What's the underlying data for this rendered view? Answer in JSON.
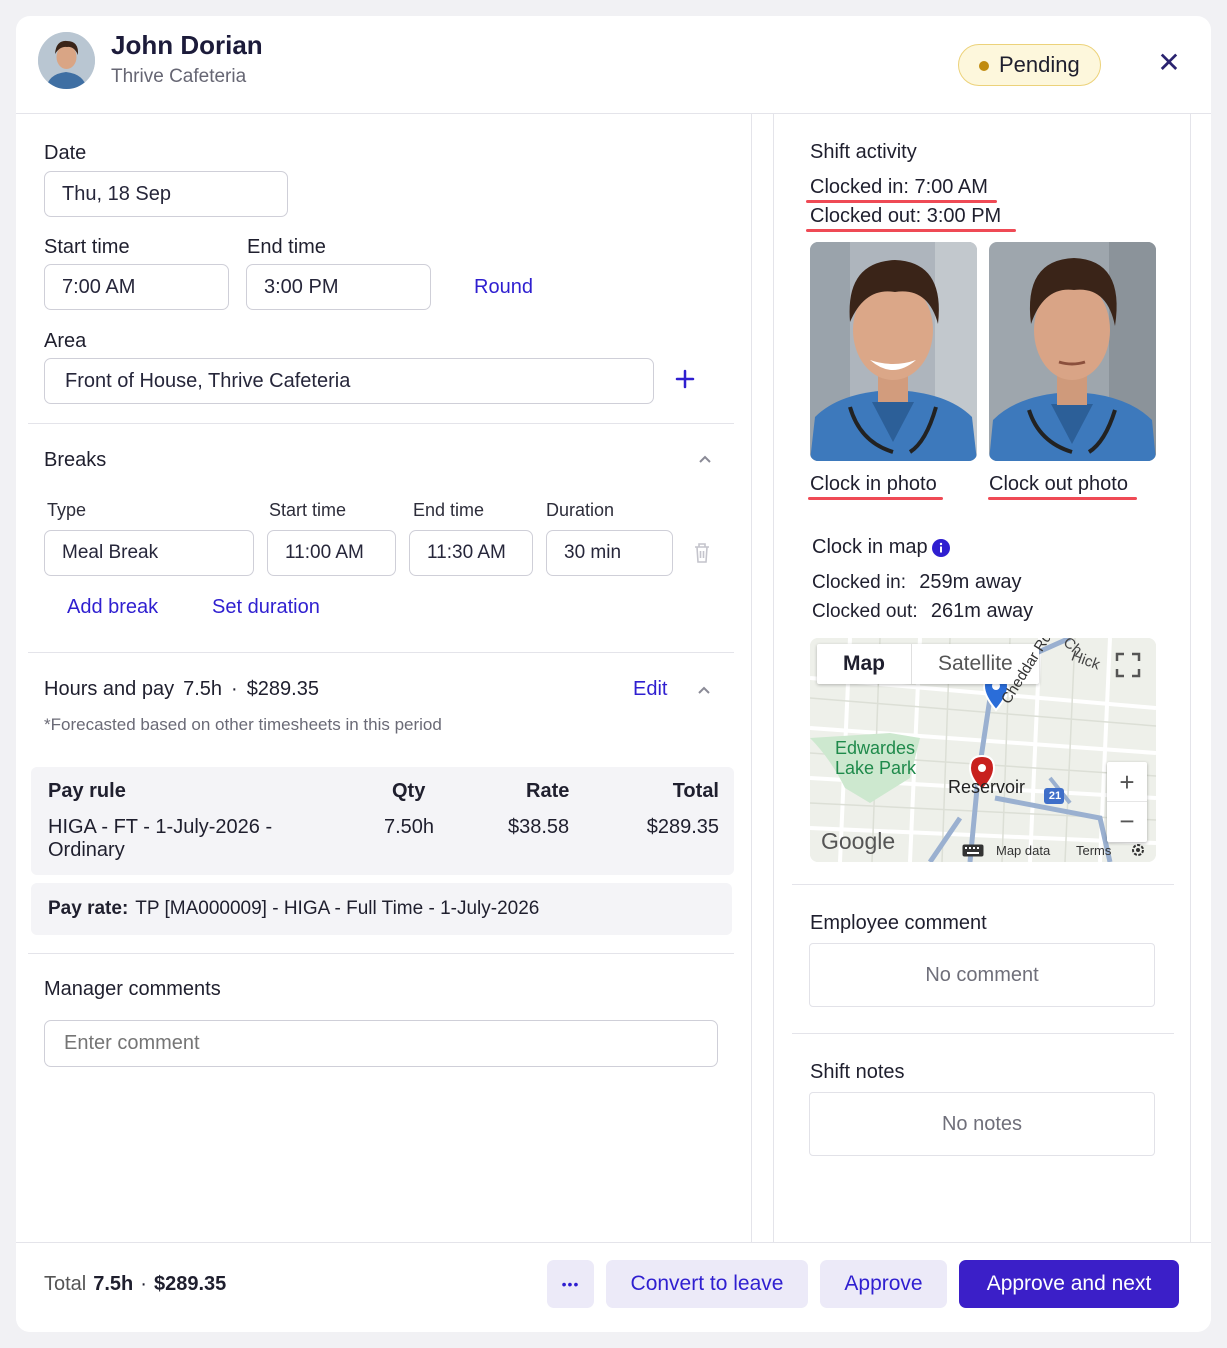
{
  "header": {
    "name": "John Dorian",
    "location": "Thrive Cafeteria",
    "status": "Pending"
  },
  "form": {
    "date_label": "Date",
    "date_value": "Thu, 18 Sep",
    "start_label": "Start time",
    "start_value": "7:00 AM",
    "end_label": "End time",
    "end_value": "3:00 PM",
    "round_label": "Round",
    "area_label": "Area",
    "area_value": "Front of House, Thrive Cafeteria"
  },
  "breaks": {
    "title": "Breaks",
    "col_type": "Type",
    "col_start": "Start time",
    "col_end": "End time",
    "col_duration": "Duration",
    "row": {
      "type": "Meal Break",
      "start": "11:00 AM",
      "end": "11:30 AM",
      "duration": "30 min"
    },
    "add_break": "Add break",
    "set_duration": "Set duration"
  },
  "hours": {
    "title": "Hours and pay",
    "hours": "7.5h",
    "sep": "·",
    "amount": "$289.35",
    "edit": "Edit",
    "note": "*Forecasted based on other timesheets in this period",
    "table": {
      "headers": [
        "Pay rule",
        "Qty",
        "Rate",
        "Total"
      ],
      "rule_line1": "HIGA - FT - 1-July-2026 -",
      "rule_line2": "Ordinary",
      "qty": "7.50h",
      "rate": "$38.58",
      "total": "$289.35"
    },
    "pay_rate_label": "Pay rate:",
    "pay_rate_value": "TP [MA000009] - HIGA - Full Time - 1-July-2026"
  },
  "manager": {
    "title": "Manager comments",
    "placeholder": "Enter comment"
  },
  "activity": {
    "title": "Shift activity",
    "clocked_in": "Clocked in: 7:00 AM",
    "clocked_out": "Clocked out: 3:00 PM",
    "clock_in_photo": "Clock in photo",
    "clock_out_photo": "Clock out photo",
    "map_title": "Clock in map",
    "map_in_label": "Clocked in:",
    "map_in_value": "259m away",
    "map_out_label": "Clocked out:",
    "map_out_value": "261m away",
    "map": {
      "tab_map": "Map",
      "tab_satellite": "Satellite",
      "park_line1": "Edwardes",
      "park_line2": "Lake Park",
      "suburb": "Reservoir",
      "road": "Cheddar Rd",
      "road2": "Hick",
      "road3": "Ch",
      "route": "21",
      "brand": "Google",
      "map_data": "Map data",
      "terms": "Terms"
    }
  },
  "employee_comment": {
    "title": "Employee comment",
    "value": "No comment"
  },
  "shift_notes": {
    "title": "Shift notes",
    "value": "No notes"
  },
  "footer": {
    "total_label": "Total",
    "total_hours": "7.5h",
    "sep": "·",
    "total_amount": "$289.35",
    "more": "•••",
    "convert": "Convert to leave",
    "approve": "Approve",
    "approve_next": "Approve and next"
  },
  "colors": {
    "accent": "#3b1fc8",
    "link": "#2f1fd0",
    "pending_bg": "#fdf7dc",
    "pending_dot": "#c08b10",
    "highlight": "#ef4a55"
  }
}
